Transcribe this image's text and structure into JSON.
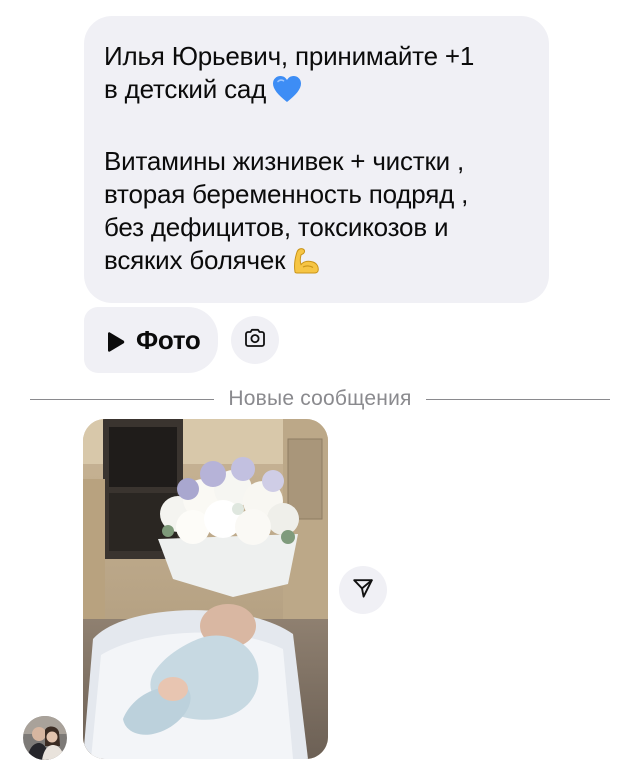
{
  "message": {
    "paragraph1": "Илья Юрьевич, принимайте +1\nв детский сад",
    "paragraph1_emoji": "blue-heart",
    "paragraph2": "Витамины жизнивек + чистки ,\nвторая беременность подряд ,\nбез дефицитов, токсикозов и\nвсяких болячек",
    "paragraph2_emoji": "flexed-biceps"
  },
  "photo_button": {
    "icon": "play-icon",
    "label": "Фото"
  },
  "camera_button": {
    "icon": "camera-icon"
  },
  "divider": {
    "label": "Новые сообщения"
  },
  "attachment": {
    "kind": "photo",
    "subject": "newborn-with-flowers"
  },
  "share_button": {
    "icon": "send-icon"
  },
  "colors": {
    "bubble": "#f0f0f5",
    "divider_text": "#8a8a8e",
    "heart": "#3d8df5",
    "biceps": "#f6c544"
  }
}
